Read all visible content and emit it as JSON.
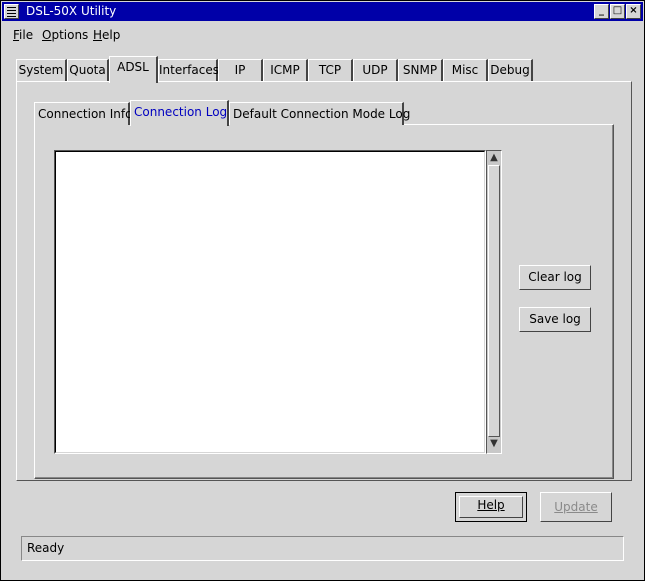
{
  "window": {
    "title": "DSL-50X Utility",
    "controls": {
      "minimize": "_",
      "maximize": "□",
      "close": "×"
    }
  },
  "menubar": {
    "items": [
      {
        "label": "File",
        "mnemonic": "F",
        "rest": "ile"
      },
      {
        "label": "Options",
        "mnemonic": "O",
        "rest": "ptions"
      },
      {
        "label": "Help",
        "mnemonic": "H",
        "rest": "elp"
      }
    ]
  },
  "outer_tabs": {
    "items": [
      "System",
      "Quota",
      "ADSL",
      "Interfaces",
      "IP",
      "ICMP",
      "TCP",
      "UDP",
      "SNMP",
      "Misc",
      "Debug"
    ],
    "active": "ADSL"
  },
  "inner_tabs": {
    "items": [
      "Connection Info",
      "Connection Log",
      "Default Connection Mode Log"
    ],
    "active": "Connection Log"
  },
  "log": {
    "content": ""
  },
  "buttons": {
    "clear_log": "Clear log",
    "save_log": "Save log",
    "help": "Help",
    "update": "Update"
  },
  "status": {
    "text": "Ready"
  },
  "scrollbar": {
    "up_arrow": "▲",
    "down_arrow": "▼"
  }
}
